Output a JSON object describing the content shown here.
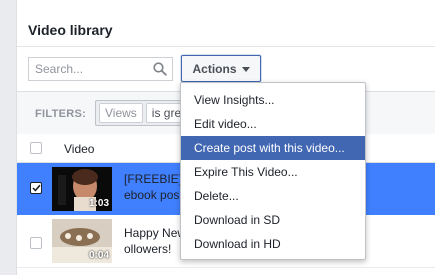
{
  "header": {
    "title": "Video library"
  },
  "search": {
    "placeholder": "Search..."
  },
  "actions": {
    "label": "Actions"
  },
  "filters": {
    "label": "FILTERS:",
    "chips": [
      "Views",
      "is gre"
    ]
  },
  "table": {
    "column_video": "Video",
    "rows": [
      {
        "title_line1": "[FREEBIE]",
        "title_line2": "ebook pos",
        "duration": "1:03",
        "selected": true
      },
      {
        "title_line1": "Happy New",
        "title_line2": "ollowers!",
        "duration": "0:04",
        "selected": false
      }
    ]
  },
  "menu": {
    "items": [
      "View Insights...",
      "Edit video...",
      "Create post with this video...",
      "Expire This Video...",
      "Delete...",
      "Download in SD",
      "Download in HD"
    ],
    "highlighted": "Create post with this video..."
  },
  "colors": {
    "accent": "#4267b2",
    "row_selected": "#4080ff",
    "page_bg": "#e9ebee"
  }
}
